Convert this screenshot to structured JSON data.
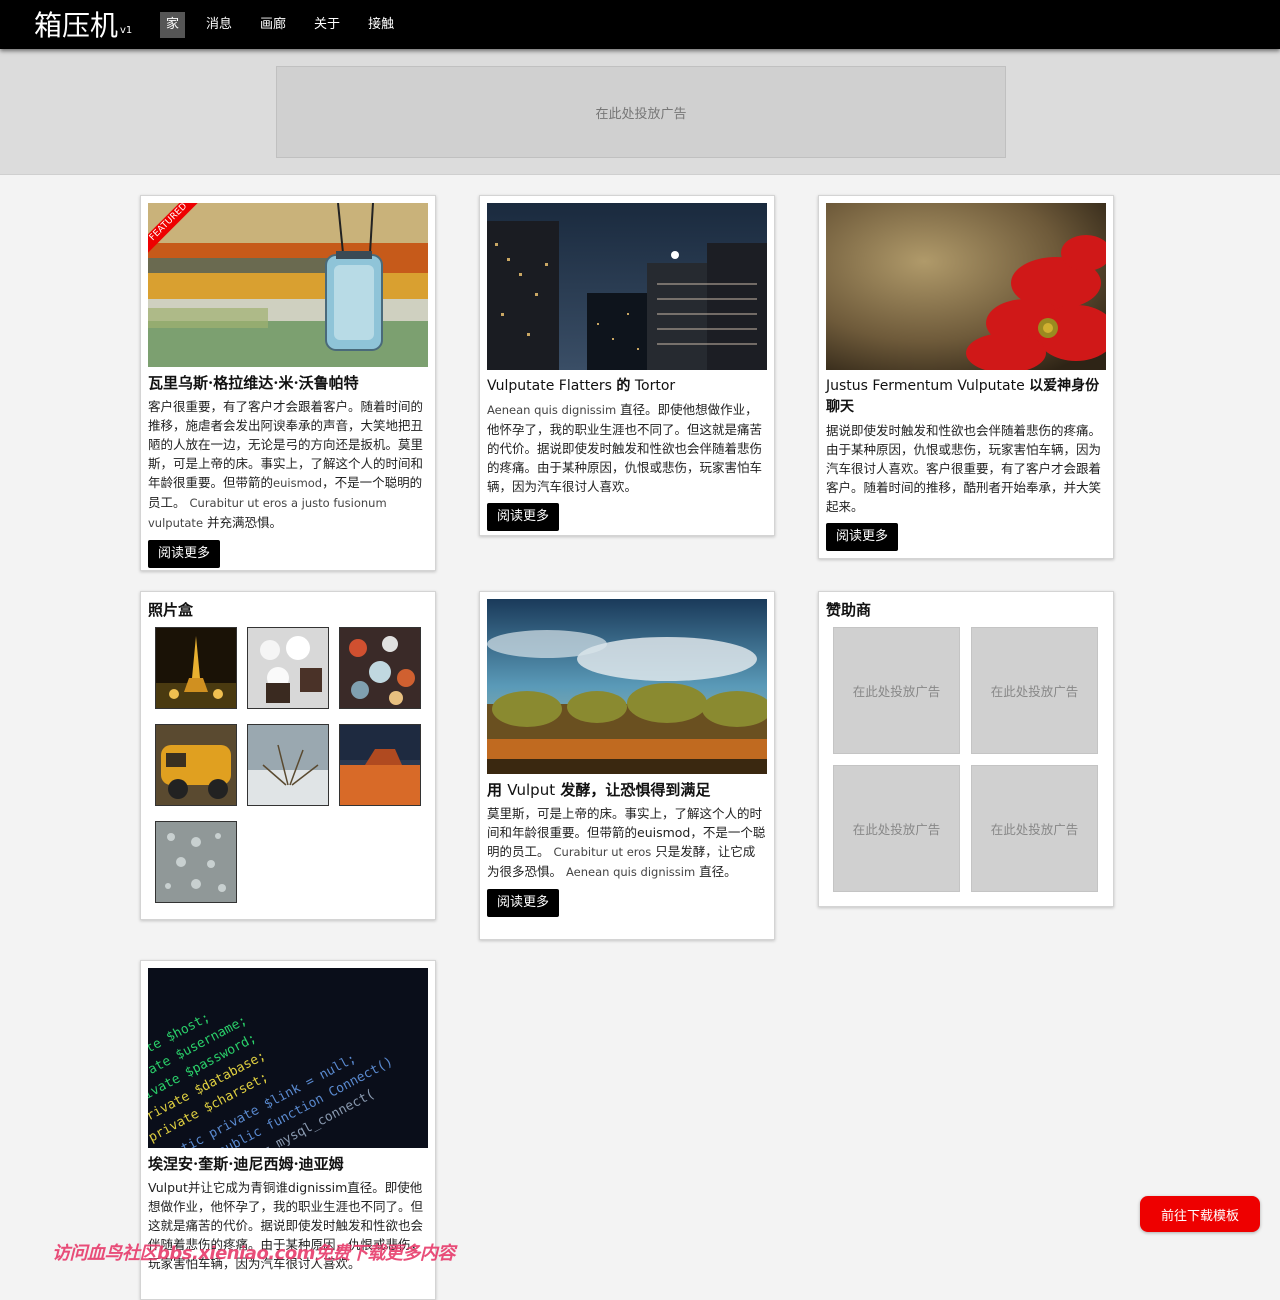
{
  "brand": {
    "name": "箱压机",
    "version": "v1"
  },
  "nav": [
    "家",
    "消息",
    "画廊",
    "关于",
    "接触"
  ],
  "top_ad": "在此处投放广告",
  "posts": [
    {
      "title": "瓦里乌斯·格拉维达·米·沃鲁帕特",
      "badge": "FEATURED",
      "body_zh": "客户很重要，有了客户才会跟着客户。随着时间的推移，施虐者会发出阿谀奉承的声音，大笑地把丑陋的人放在一边，无论是弓的方向还是扳机。莫里斯，可是上帝的床。事实上，了解这个人的时间和年龄很重要。但带箭的",
      "body_en1": "euismod",
      "body_zh2": "，不是一个聪明的员工。",
      "body_en2": "Curabitur ut eros a justo fusionum vulputate",
      "body_zh3": "并充满恐惧。",
      "button": "阅读更多"
    },
    {
      "title_en": "Vulputate Flatters",
      "title_zh": "的",
      "title_en2": "Tortor",
      "body_en": "Aenean quis dignissim",
      "body_zh": "直径。即使他想做作业，他怀孕了，我的职业生涯也不同了。但这就是痛苦的代价。据说即使发时触发和性欲也会伴随着悲伤的疼痛。由于某种原因，仇恨或悲伤，玩家害怕车辆，因为汽车很讨人喜欢。",
      "button": "阅读更多"
    },
    {
      "title_en": "Justus Fermentum Vulputate",
      "title_zh": "以爱神身份聊天",
      "body_zh": "据说即使发时触发和性欲也会伴随着悲伤的疼痛。由于某种原因，仇恨或悲伤，玩家害怕车辆，因为汽车很讨人喜欢。客户很重要，有了客户才会跟着客户。随着时间的推移，酷刑者开始奉承，并大笑起来。",
      "button": "阅读更多"
    },
    {
      "title_zh1": "用",
      "title_en": "Vulput",
      "title_zh2": "发酵，让恐惧得到满足",
      "body_zh": "莫里斯，可是上帝的床。事实上，了解这个人的时间和年龄很重要。但带箭的euismod，不是一个聪明的员工。",
      "body_en1": "Curabitur ut eros",
      "body_zh2": "只是发酵，让它成为很多恐惧。",
      "body_en2": "Aenean quis dignissim",
      "body_zh3": "直径。",
      "button": "阅读更多"
    },
    {
      "title": "埃涅安·奎斯·迪尼西姆·迪亚姆",
      "body": "Vulput并让它成为青铜谁dignissim直径。即使他想做作业，他怀孕了，我的职业生涯也不同了。但这就是痛苦的代价。据说即使发时触发和性欲也会伴随着悲伤的疼痛。由于某种原因，仇恨或悲伤，玩家害怕车辆，因为汽车很讨人喜欢。"
    }
  ],
  "photobox": {
    "title": "照片盒"
  },
  "sponsors": {
    "title": "赞助商",
    "ads": [
      "在此处投放广告",
      "在此处投放广告",
      "在此处投放广告",
      "在此处投放广告"
    ]
  },
  "download_button": "前往下载模板",
  "watermark": "访问血鸟社区bbs.xieniao.com免费下载更多内容"
}
